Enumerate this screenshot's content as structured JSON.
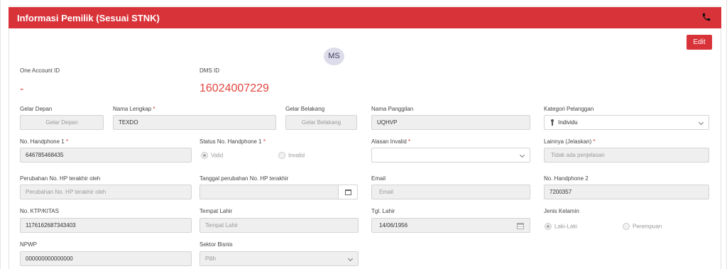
{
  "header": {
    "title": "Informasi Pemilik (Sesuai STNK)",
    "icon": "phone-icon"
  },
  "actions": {
    "edit_label": "Edit"
  },
  "avatar": {
    "initials": "MS"
  },
  "account": {
    "one_account_label": "One Account ID",
    "one_account_value": "-",
    "dms_label": "DMS ID",
    "dms_value": "16024007229"
  },
  "fields": {
    "gelar_depan": {
      "label": "Gelar Depan",
      "placeholder": "Gelar Depan"
    },
    "nama_lengkap": {
      "label": "Nama Lengkap",
      "required": "*",
      "value": "TEXDO"
    },
    "gelar_belakang": {
      "label": "Gelar Belakang",
      "placeholder": "Gelar Belakang"
    },
    "nama_panggilan": {
      "label": "Nama Panggilan",
      "value": "UQHVP"
    },
    "kategori_pelanggan": {
      "label": "Kategori Pelanggan",
      "value": "Individu",
      "icon": "person-icon"
    },
    "no_hp_1": {
      "label": "No. Handphone 1",
      "required": "*",
      "value": "646785468435"
    },
    "status_hp_1": {
      "label": "Status No. Handphone 1",
      "required": "*",
      "options": [
        "Valid",
        "Invalid"
      ],
      "selected": "Valid"
    },
    "alasan_invalid": {
      "label": "Alasan Invalid",
      "required": "*",
      "value": ""
    },
    "lainnya": {
      "label": "Lainnya (Jelaskan)",
      "required": "*",
      "placeholder": "Tidak ada penjelasan"
    },
    "perubahan_hp": {
      "label": "Perubahan No. HP terakhir oleh",
      "placeholder": "Perubahan No. HP terakhir oleh"
    },
    "tanggal_perubahan": {
      "label": "Tanggal perubahan No. HP terakhir",
      "value": ""
    },
    "email": {
      "label": "Email",
      "placeholder": "Email"
    },
    "no_hp_2": {
      "label": "No. Handphone 2",
      "value": "7200357"
    },
    "ktp": {
      "label": "No. KTP/KITAS",
      "value": "1176162687343403"
    },
    "tempat_lahir": {
      "label": "Tempat Lahir",
      "placeholder": "Tempat Lahir"
    },
    "tgl_lahir": {
      "label": "Tgl. Lahir",
      "value": "14/06/1956"
    },
    "jenis_kelamin": {
      "label": "Jenis Kelamin",
      "options": [
        "Laki-Laki",
        "Perempuan"
      ],
      "selected": "Laki-Laki"
    },
    "npwp": {
      "label": "NPWP",
      "value": "000000000000000"
    },
    "sektor_bisnis": {
      "label": "Sektor Bisnis",
      "value": "Pilih"
    }
  },
  "colors": {
    "brand": "#d9333a",
    "accent_value": "#e0463e"
  }
}
